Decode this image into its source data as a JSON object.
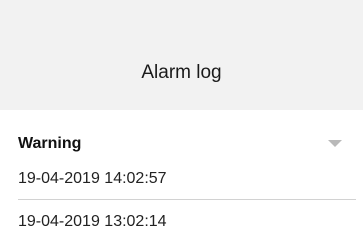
{
  "header": {
    "title": "Alarm log"
  },
  "filter": {
    "label": "Warning",
    "icon": "chevron-down-icon"
  },
  "entries": [
    {
      "timestamp": "19-04-2019 14:02:57"
    },
    {
      "timestamp": "19-04-2019 13:02:14"
    }
  ],
  "colors": {
    "header_bg": "#f2f2f2",
    "text": "#222222",
    "arrow": "#b9b9b9",
    "divider": "#d2d2d2"
  }
}
